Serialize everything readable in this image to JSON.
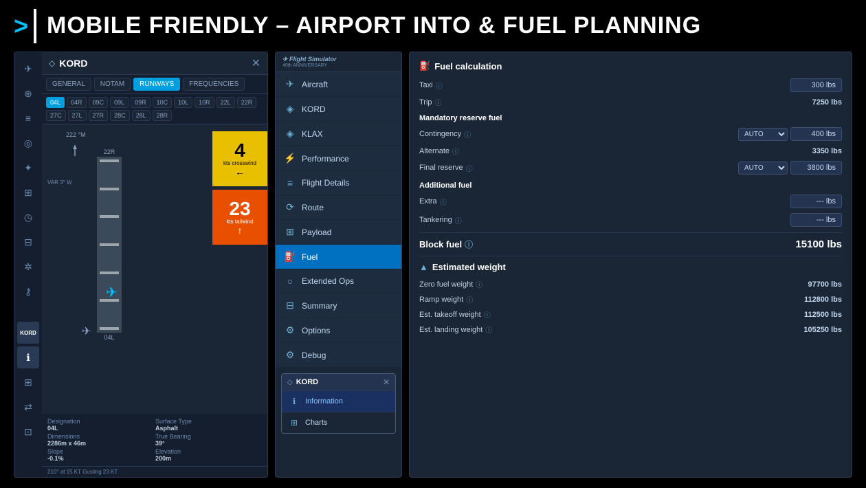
{
  "header": {
    "arrow": ">",
    "title": "MOBILE FRIENDLY – AIRPORT INTO & FUEL PLANNING"
  },
  "left_panel": {
    "title": "KORD",
    "tabs": [
      "GENERAL",
      "NOTAM",
      "RUNWAYS",
      "FREQUENCIES"
    ],
    "active_tab": "RUNWAYS",
    "runways": [
      "04L",
      "04R",
      "09C",
      "09L",
      "09R",
      "10C",
      "10L",
      "10R",
      "22L",
      "22R",
      "27C",
      "27L",
      "27R",
      "28C",
      "28L",
      "28R"
    ],
    "active_runway": "04L",
    "compass": "222 °M",
    "var_label": "VAR 3° W",
    "runway_top": "22R",
    "runway_bottom": "04L",
    "wind_crosswind": "4",
    "wind_crosswind_label": "kts crosswind",
    "wind_tailwind": "23",
    "wind_tailwind_label": "kts tailwind",
    "designation_label": "Designation",
    "designation_value": "04L",
    "surface_label": "Surface Type",
    "surface_value": "Asphalt",
    "dimensions_label": "Dimensions",
    "dimensions_value": "2286m x 46m",
    "bearing_label": "True Bearing",
    "bearing_value": "39°",
    "slope_label": "Slope",
    "slope_value": "-0.1%",
    "elevation_label": "Elevation",
    "elevation_value": "200m",
    "weather": "210° at 15 KT Gusting 23 KT"
  },
  "middle_panel": {
    "nav_items": [
      {
        "id": "aircraft",
        "icon": "✈",
        "label": "Aircraft"
      },
      {
        "id": "kord",
        "icon": "◈",
        "label": "KORD"
      },
      {
        "id": "klax",
        "icon": "◈",
        "label": "KLAX"
      },
      {
        "id": "performance",
        "icon": "⚡",
        "label": "Performance"
      },
      {
        "id": "flight-details",
        "icon": "≡",
        "label": "Flight Details"
      },
      {
        "id": "route",
        "icon": "⟳",
        "label": "Route"
      },
      {
        "id": "payload",
        "icon": "⊞",
        "label": "Payload"
      },
      {
        "id": "fuel",
        "icon": "⛽",
        "label": "Fuel"
      },
      {
        "id": "extended-ops",
        "icon": "○",
        "label": "Extended Ops"
      },
      {
        "id": "summary",
        "icon": "⊟",
        "label": "Summary"
      },
      {
        "id": "options",
        "icon": "⚙",
        "label": "Options"
      },
      {
        "id": "debug",
        "icon": "⚙",
        "label": "Debug"
      }
    ],
    "active_nav": "fuel",
    "kord_subpanel": {
      "title": "KORD",
      "items": [
        {
          "id": "information",
          "icon": "ℹ",
          "label": "Information"
        },
        {
          "id": "charts",
          "icon": "⊞",
          "label": "Charts"
        }
      ],
      "active_item": "information"
    }
  },
  "right_panel": {
    "fuel_section_title": "Fuel calculation",
    "taxi_label": "Taxi",
    "taxi_value": "300 lbs",
    "trip_label": "Trip",
    "trip_value": "7250 lbs",
    "mandatory_reserve_label": "Mandatory reserve fuel",
    "contingency_label": "Contingency",
    "contingency_select": "AUTO",
    "contingency_value": "400 lbs",
    "alternate_label": "Alternate",
    "alternate_value": "3350 lbs",
    "final_reserve_label": "Final reserve",
    "final_reserve_select": "AUTO",
    "final_reserve_value": "3800 lbs",
    "additional_fuel_label": "Additional fuel",
    "extra_label": "Extra",
    "extra_value": "--- lbs",
    "tankering_label": "Tankering",
    "tankering_value": "--- lbs",
    "block_fuel_label": "Block fuel",
    "block_fuel_value": "15100 lbs",
    "est_weight_title": "Estimated weight",
    "zero_fuel_label": "Zero fuel weight",
    "zero_fuel_value": "97700 lbs",
    "ramp_label": "Ramp weight",
    "ramp_value": "112800 lbs",
    "takeoff_label": "Est. takeoff weight",
    "takeoff_value": "112500 lbs",
    "landing_label": "Est. landing weight",
    "landing_value": "105250 lbs"
  }
}
